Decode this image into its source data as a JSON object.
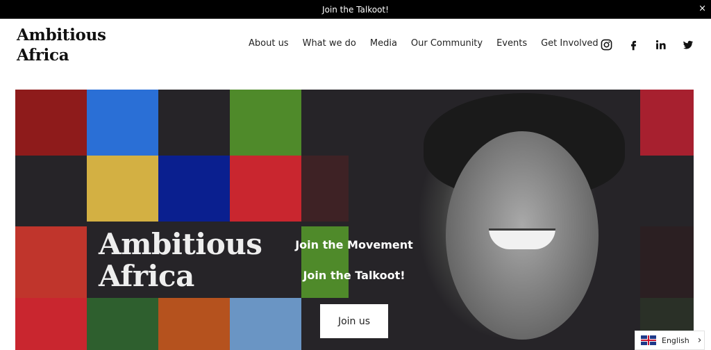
{
  "announcement": {
    "text": "Join the Talkoot!",
    "close_icon": "×"
  },
  "brand": {
    "line1": "Ambitious",
    "line2": "Africa"
  },
  "nav": [
    {
      "label": "About us"
    },
    {
      "label": "What we do"
    },
    {
      "label": "Media"
    },
    {
      "label": "Our Community"
    },
    {
      "label": "Events"
    },
    {
      "label": "Get Involved"
    }
  ],
  "social": [
    "instagram-icon",
    "facebook-icon",
    "linkedin-icon",
    "twitter-icon"
  ],
  "hero": {
    "title_line1": "Ambitious",
    "title_line2": "Africa",
    "tagline1": "Join the Movement",
    "tagline2": "Join the Talkoot!",
    "cta": "Join us",
    "tile_colors": {
      "dark_red": "#8e1b1b",
      "blue": "#2a6fd6",
      "green": "#4f8a2a",
      "crimson": "#a7202f",
      "yellow": "#d3b043",
      "navy": "#0a1f8f",
      "red": "#c9262f",
      "maroon": "#3e2225",
      "brick": "#c0352c",
      "forest": "#2e5f2e",
      "orange": "#b5521e",
      "steel": "#6a95c4"
    }
  },
  "language": {
    "label": "English",
    "chevron": "›"
  }
}
